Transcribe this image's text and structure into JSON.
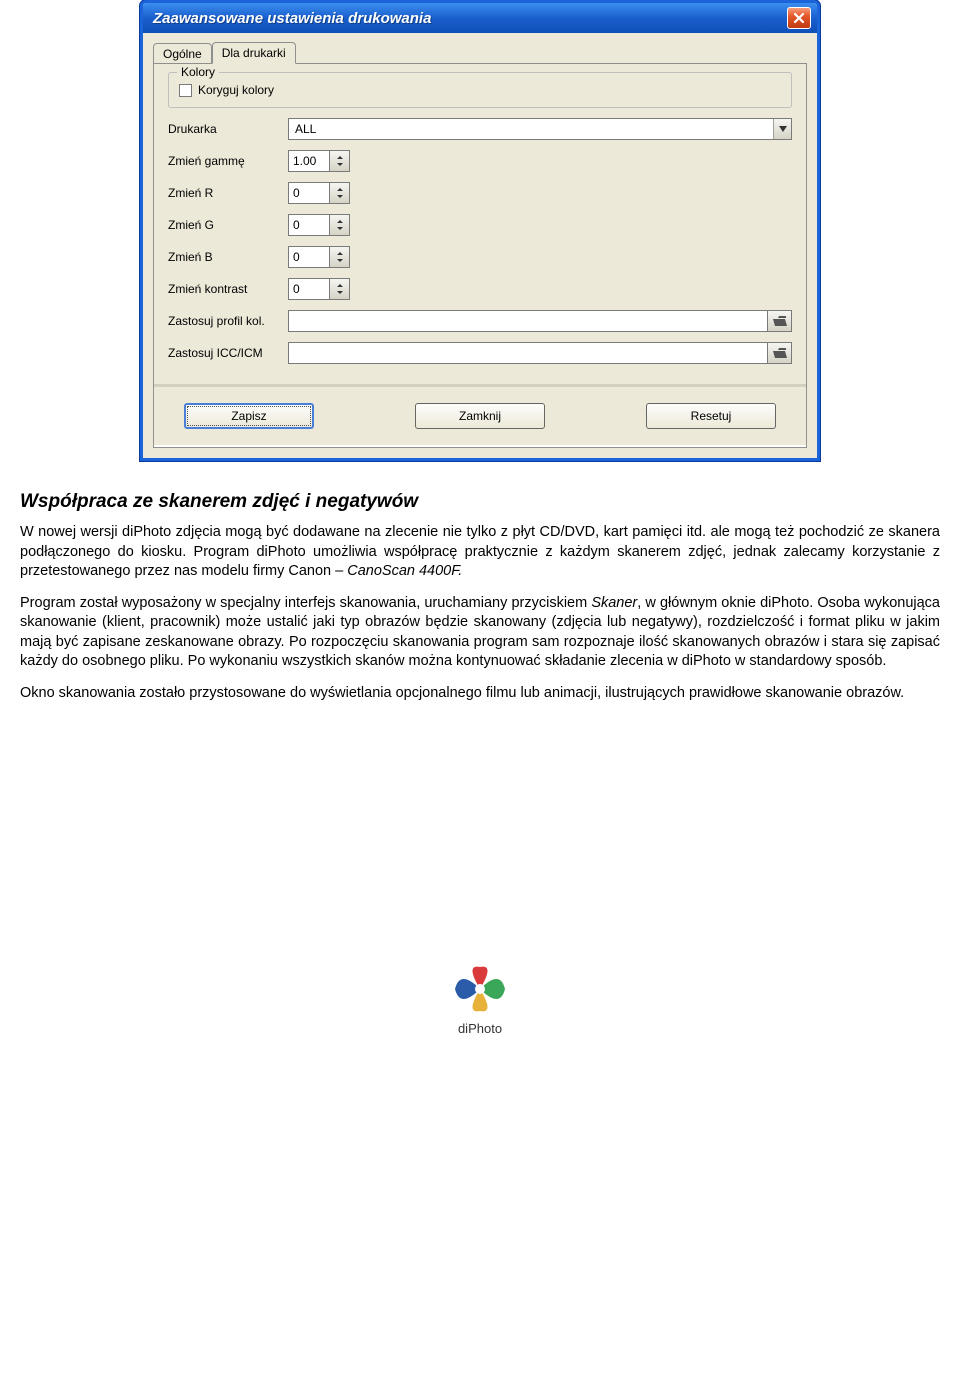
{
  "dialog": {
    "title": "Zaawansowane ustawienia drukowania",
    "tabs": {
      "general": "Ogólne",
      "printer": "Dla drukarki"
    },
    "fieldset_colors": "Kolory",
    "checkbox_correct": "Koryguj kolory",
    "labels": {
      "printer": "Drukarka",
      "gamma": "Zmień gammę",
      "r": "Zmień R",
      "g": "Zmień G",
      "b": "Zmień B",
      "contrast": "Zmień kontrast",
      "profile": "Zastosuj profil kol.",
      "icc": "Zastosuj ICC/ICM"
    },
    "values": {
      "printer": "ALL",
      "gamma": "1.00",
      "r": "0",
      "g": "0",
      "b": "0",
      "contrast": "0",
      "profile": "",
      "icc": ""
    },
    "buttons": {
      "save": "Zapisz",
      "close": "Zamknij",
      "reset": "Resetuj"
    }
  },
  "doc": {
    "heading": "Współpraca ze skanerem zdjęć i negatywów",
    "p1a": "W nowej wersji diPhoto zdjęcia mogą być dodawane na zlecenie nie tylko z płyt CD/DVD, kart pamięci itd. ale mogą też pochodzić ze skanera podłączonego do kiosku. Program diPhoto umożliwia współpracę praktycznie z każdym skanerem zdjęć, jednak zalecamy korzystanie z przetestowanego przez nas modelu firmy Canon – ",
    "p1b": "CanoScan 4400F.",
    "p2a": "Program został wyposażony w specjalny interfejs skanowania, uruchamiany przyciskiem ",
    "p2b": "Skaner",
    "p2c": ", w głównym oknie diPhoto. Osoba wykonująca skanowanie (klient, pracownik) może ustalić jaki typ obrazów będzie skanowany (zdjęcia lub negatywy), rozdzielczość i format pliku w jakim mają być zapisane zeskanowane obrazy. Po rozpoczęciu skanowania program sam rozpoznaje ilość skanowanych obrazów i stara się zapisać każdy do osobnego pliku. Po wykonaniu wszystkich skanów można kontynuować składanie zlecenia w diPhoto w standardowy sposób.",
    "p3": "Okno skanowania zostało przystosowane do wyświetlania opcjonalnego filmu lub animacji, ilustrujących prawidłowe skanowanie obrazów.",
    "logo_caption": "diPhoto"
  }
}
